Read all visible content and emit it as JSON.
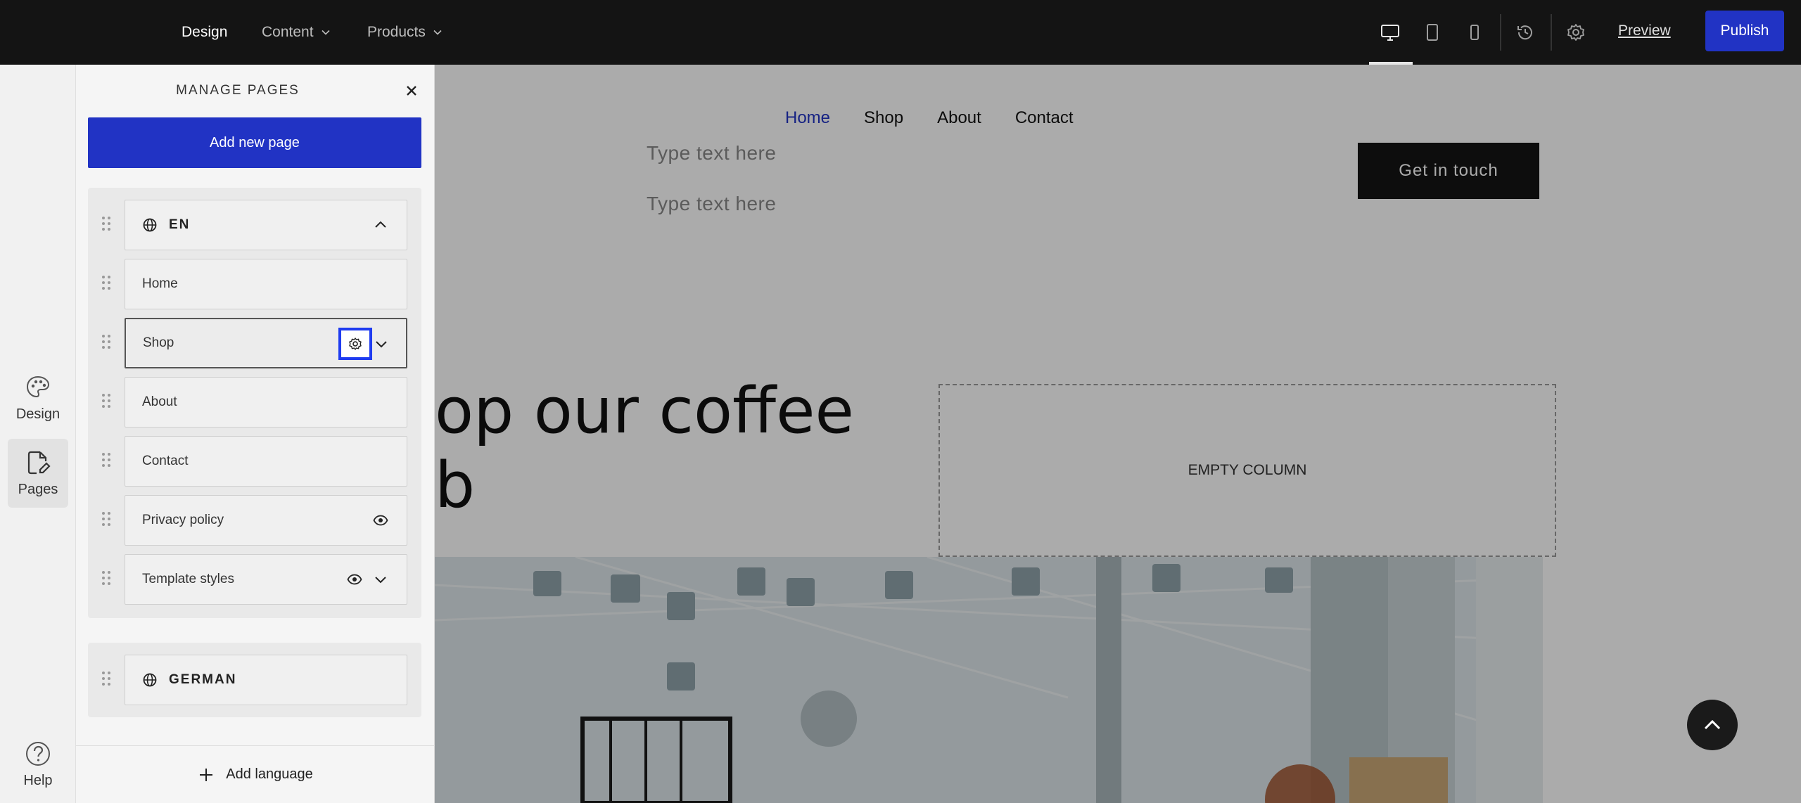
{
  "topbar": {
    "tabs": [
      {
        "label": "Design",
        "active": true
      },
      {
        "label": "Content",
        "active": false
      },
      {
        "label": "Products",
        "active": false
      }
    ],
    "icons": [
      "desktop-icon",
      "tablet-icon",
      "mobile-icon",
      "history-icon",
      "settings-gear-icon"
    ],
    "preview_label": "Preview",
    "publish_label": "Publish",
    "accent_color": "#2133c4"
  },
  "rail": {
    "items": [
      {
        "label": "Design",
        "icon": "palette-icon",
        "active": false
      },
      {
        "label": "Pages",
        "icon": "page-edit-icon",
        "active": true
      }
    ],
    "help_label": "Help"
  },
  "panel": {
    "title": "MANAGE PAGES",
    "add_page_label": "Add new page",
    "languages": [
      {
        "code": "EN",
        "expanded": true,
        "pages": [
          {
            "label": "Home",
            "actions": []
          },
          {
            "label": "Shop",
            "actions": [
              "gear-icon",
              "chevron-down-icon"
            ],
            "selected": true
          },
          {
            "label": "About",
            "actions": []
          },
          {
            "label": "Contact",
            "actions": []
          },
          {
            "label": "Privacy policy",
            "actions": [
              "eye-icon"
            ]
          },
          {
            "label": "Template styles",
            "actions": [
              "eye-icon",
              "chevron-down-icon"
            ]
          }
        ]
      },
      {
        "code": "GERMAN",
        "expanded": false,
        "pages": []
      }
    ],
    "add_language_label": "Add language"
  },
  "site": {
    "nav": [
      {
        "label": "Home",
        "active": true
      },
      {
        "label": "Shop",
        "active": false
      },
      {
        "label": "About",
        "active": false
      },
      {
        "label": "Contact",
        "active": false
      }
    ],
    "text_placeholder_1": "Type text here",
    "text_placeholder_2": "Type text here",
    "cta_label": "Get in touch",
    "hero_title": "op our coffee\nb",
    "empty_column_label": "EMPTY COLUMN"
  }
}
